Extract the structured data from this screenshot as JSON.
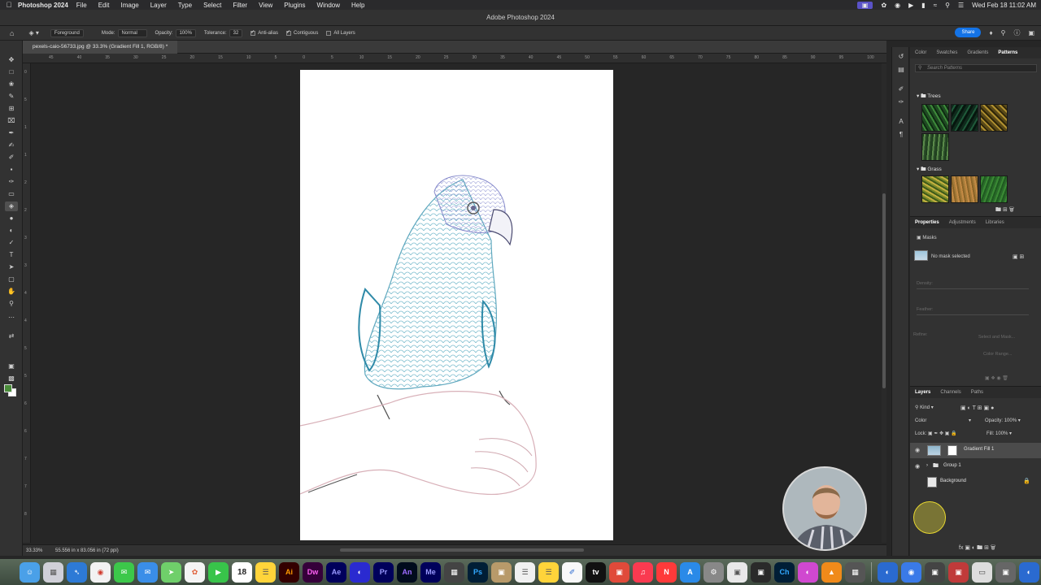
{
  "menubar": {
    "app_name": "Photoshop 2024",
    "menus": [
      "File",
      "Edit",
      "Image",
      "Layer",
      "Type",
      "Select",
      "Filter",
      "View",
      "Plugins",
      "Window",
      "Help"
    ],
    "clock": "Wed Feb 18  11:02 AM"
  },
  "window": {
    "title": "Adobe Photoshop 2024"
  },
  "options": {
    "fill_source": "Foreground",
    "mode_label": "Mode:",
    "mode_value": "Normal",
    "opacity_label": "Opacity:",
    "opacity_value": "100%",
    "tolerance_label": "Tolerance:",
    "tolerance_value": "32",
    "antialias_label": "Anti-alias",
    "contiguous_label": "Contiguous",
    "all_layers_label": "All Layers",
    "share_label": "Share"
  },
  "document": {
    "tab_title": "pexels-caio-56733.jpg @ 33.3% (Gradient Fill 1, RGB/8) *",
    "zoom": "33.33%",
    "dimensions": "55.556 in x 83.056 in (72 ppi)"
  },
  "ruler": {
    "h_ticks": [
      "45",
      "40",
      "35",
      "30",
      "25",
      "20",
      "15",
      "10",
      "5",
      "0",
      "5",
      "10",
      "15",
      "20",
      "25",
      "30",
      "35",
      "40",
      "45",
      "50",
      "55",
      "60",
      "65",
      "70",
      "75",
      "80",
      "85",
      "90",
      "95",
      "100"
    ],
    "v_ticks": [
      "0",
      "5",
      "1",
      "1",
      "2",
      "2",
      "3",
      "3",
      "4",
      "4",
      "5",
      "5",
      "6",
      "6",
      "7",
      "7",
      "8"
    ]
  },
  "panels": {
    "top_tabs": [
      "Color",
      "Swatches",
      "Gradients",
      "Patterns"
    ],
    "search_placeholder": "Search Patterns",
    "group_trees": "Trees",
    "group_grass": "Grass",
    "props_tabs": [
      "Properties",
      "Adjustments",
      "Libraries"
    ],
    "masks_label": "Masks",
    "no_mask": "No mask selected",
    "density_label": "Density:",
    "feather_label": "Feather:",
    "refine_label": "Refine:",
    "select_mask_label": "Select and Mask...",
    "color_range_label": "Color Range...",
    "layers_tabs": [
      "Layers",
      "Channels",
      "Paths"
    ],
    "kind_label": "Kind",
    "blend_mode": "Color",
    "opacity_label": "Opacity:",
    "opacity_value": "100%",
    "lock_label": "Lock:",
    "fill_label": "Fill:",
    "fill_value": "100%",
    "layers": [
      {
        "name": "Gradient Fill 1"
      },
      {
        "name": "Group 1"
      },
      {
        "name": "Background"
      }
    ]
  },
  "dock_apps": [
    "Finder",
    "Launchpad",
    "Safari",
    "Chrome",
    "Messages",
    "Mail",
    "Maps",
    "Photos",
    "FaceTime",
    "Calendar",
    "Notes",
    "Illustrator",
    "Dreamweaver",
    "After Effects",
    "Premiere",
    "Animate",
    "Media Encoder",
    "Photoshop"
  ],
  "dock_labels": {
    "calendar_day": "18",
    "ai": "Ai",
    "dw": "Dw",
    "ae": "Ae",
    "pr": "Pr",
    "an": "An",
    "me": "Me",
    "ps": "Ps",
    "ch": "Ch"
  },
  "colors": {
    "accent": "#1473e6",
    "foreground_swatch": "#4a8d3a",
    "background_swatch": "#ffffff"
  }
}
